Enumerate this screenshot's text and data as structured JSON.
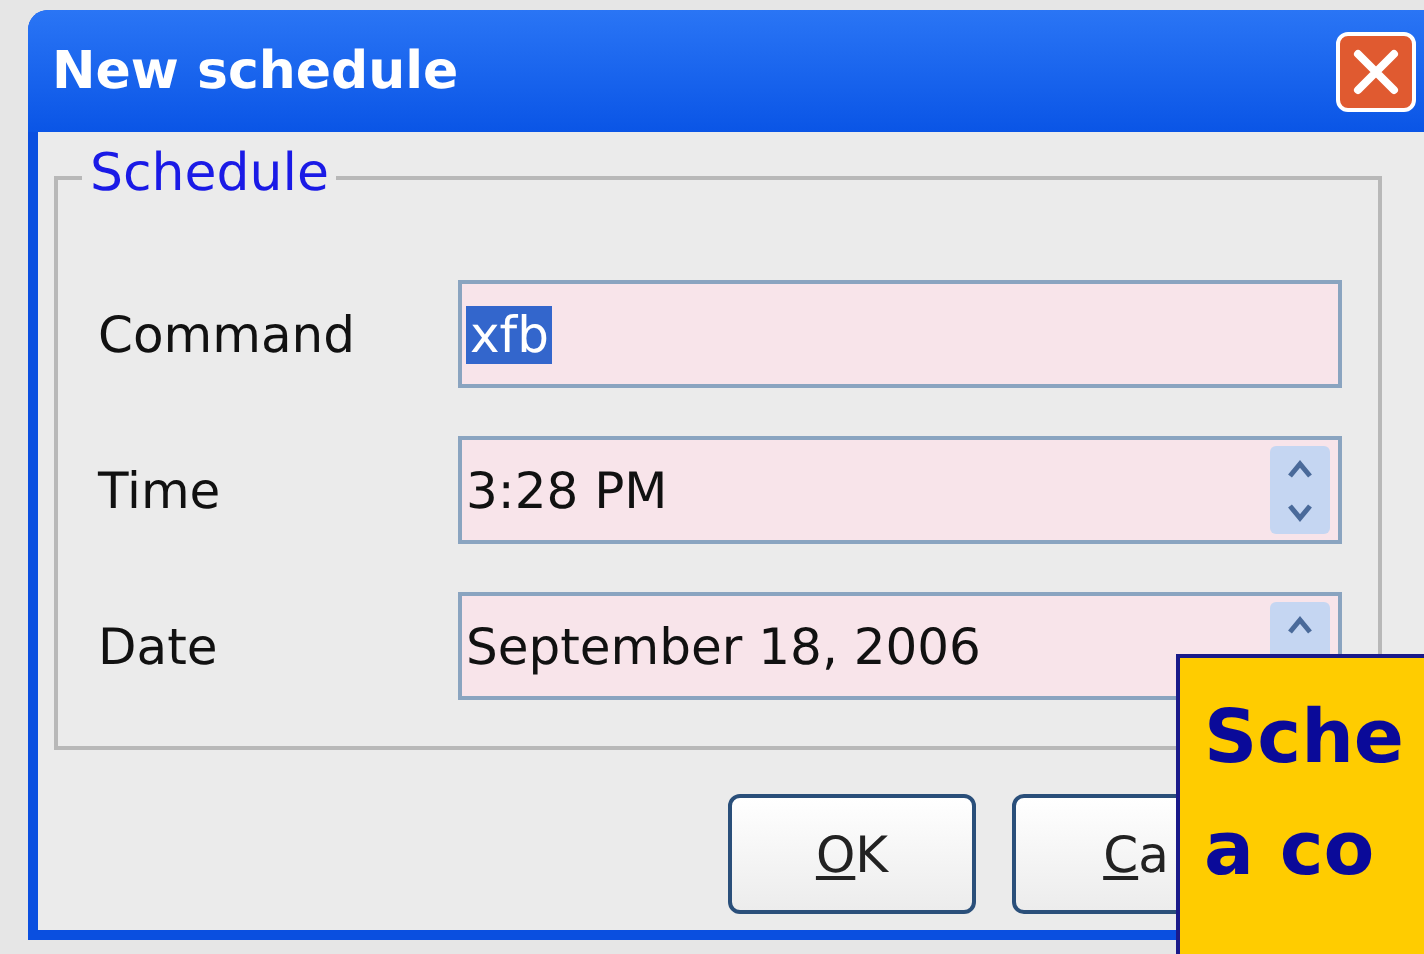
{
  "window": {
    "title": "New schedule"
  },
  "group": {
    "title": "Schedule"
  },
  "fields": [
    {
      "label": "Command",
      "value": "xfb",
      "kind": "text",
      "text_selected": true
    },
    {
      "label": "Time",
      "value": "3:28 PM",
      "kind": "spinner",
      "text_selected": false
    },
    {
      "label": "Date",
      "value": "September 18, 2006",
      "kind": "spinner",
      "text_selected": false
    }
  ],
  "buttons": [
    {
      "label": "OK"
    },
    {
      "label": "Ca"
    }
  ],
  "callout": {
    "lines": [
      "Sche",
      "a co"
    ]
  }
}
